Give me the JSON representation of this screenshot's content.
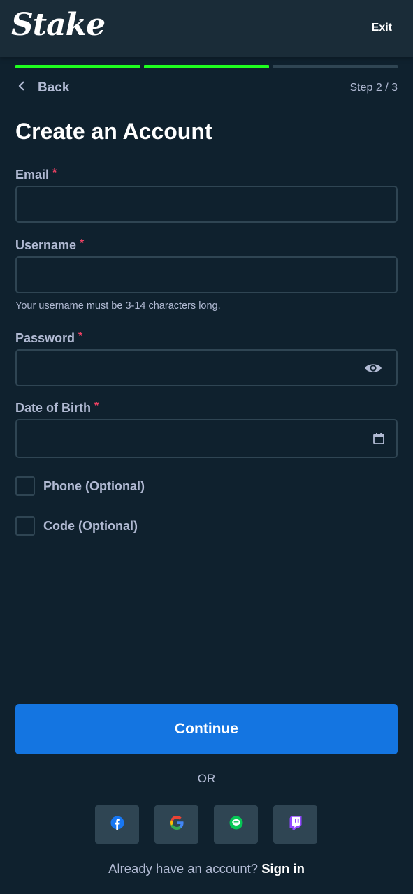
{
  "header": {
    "logo": "Stake",
    "exit_label": "Exit"
  },
  "progress": {
    "current_step": 2,
    "total_steps": 3,
    "active_color": "#1fff20",
    "inactive_color": "#2f4553"
  },
  "nav": {
    "back_label": "Back",
    "step_label": "Step 2 / 3"
  },
  "title": "Create an Account",
  "form": {
    "email": {
      "label": "Email",
      "required_mark": "*",
      "value": ""
    },
    "username": {
      "label": "Username",
      "required_mark": "*",
      "value": "",
      "hint": "Your username must be 3-14 characters long."
    },
    "password": {
      "label": "Password",
      "required_mark": "*",
      "value": "",
      "icon": "eye-icon"
    },
    "dob": {
      "label": "Date of Birth",
      "required_mark": "*",
      "value": "",
      "icon": "calendar-icon"
    },
    "phone_option": {
      "label": "Phone (Optional)",
      "checked": false
    },
    "code_option": {
      "label": "Code (Optional)",
      "checked": false
    }
  },
  "continue_label": "Continue",
  "divider_label": "OR",
  "social_logins": [
    {
      "name": "facebook",
      "icon": "facebook-icon"
    },
    {
      "name": "google",
      "icon": "google-icon"
    },
    {
      "name": "line",
      "icon": "line-icon"
    },
    {
      "name": "twitch",
      "icon": "twitch-icon"
    }
  ],
  "footer": {
    "prompt": "Already have an account?",
    "link": "Sign in"
  },
  "colors": {
    "background": "#0f212e",
    "header": "#1a2c38",
    "accent": "#1475e1",
    "muted_text": "#b1bad3",
    "required": "#ed4163"
  }
}
